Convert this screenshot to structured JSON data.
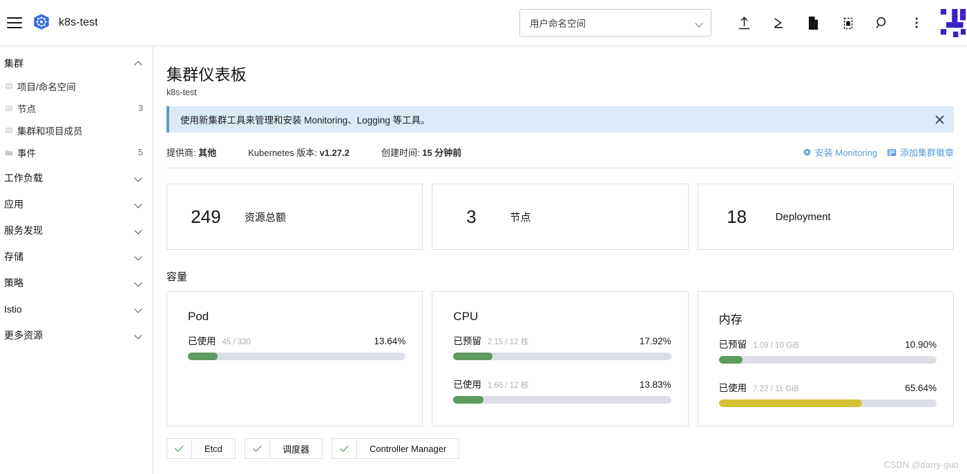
{
  "header": {
    "menu_icon": "hamburger-menu-icon",
    "cluster_logo": "kubernetes-icon",
    "cluster_name": "k8s-test",
    "namespace_filter": {
      "value": "用户命名空间",
      "caret_icon": "chevron-down-icon"
    },
    "icons": [
      {
        "name": "import-yaml-icon",
        "title": "导入 YAML"
      },
      {
        "name": "kubectl-shell-icon",
        "title": "Kubectl Shell"
      },
      {
        "name": "cluster-dashboard-icon",
        "title": "集群仪表板"
      },
      {
        "name": "copy-kubeconfig-icon",
        "title": "复制 KubeConfig"
      },
      {
        "name": "search-icon",
        "title": "搜索"
      },
      {
        "name": "more-options-icon",
        "title": "更多"
      }
    ],
    "brand_mark": "rancher-logo-icon"
  },
  "sidebar": {
    "groups": [
      {
        "label": "集群",
        "expanded": true,
        "caret_icon": "chevron-up-icon",
        "items": [
          {
            "label": "项目/命名空间",
            "count": "",
            "icon": "globe-icon"
          },
          {
            "label": "节点",
            "count": "3",
            "icon": "globe-icon"
          },
          {
            "label": "集群和项目成员",
            "count": "",
            "icon": "globe-icon"
          },
          {
            "label": "事件",
            "count": "5",
            "icon": "folder-icon"
          }
        ]
      },
      {
        "label": "工作负载",
        "expanded": false,
        "caret_icon": "chevron-down-icon",
        "items": []
      },
      {
        "label": "应用",
        "expanded": false,
        "caret_icon": "chevron-down-icon",
        "items": []
      },
      {
        "label": "服务发现",
        "expanded": false,
        "caret_icon": "chevron-down-icon",
        "items": []
      },
      {
        "label": "存储",
        "expanded": false,
        "caret_icon": "chevron-down-icon",
        "items": []
      },
      {
        "label": "策略",
        "expanded": false,
        "caret_icon": "chevron-down-icon",
        "items": []
      },
      {
        "label": "Istio",
        "expanded": false,
        "caret_icon": "chevron-down-icon",
        "items": []
      },
      {
        "label": "更多资源",
        "expanded": false,
        "caret_icon": "chevron-down-icon",
        "items": []
      }
    ]
  },
  "main": {
    "title": "集群仪表板",
    "subtitle": "k8s-test",
    "banner": {
      "text": "使用新集群工具来管理和安装 Monitoring、Logging 等工具。",
      "close_icon": "close-icon",
      "accent_color": "#5b9bd5",
      "background_color": "#dceaf7"
    },
    "meta": {
      "provider_label": "提供商:",
      "provider_value": "其他",
      "k8s_label": "Kubernetes 版本:",
      "k8s_value": "v1.27.2",
      "created_label": "创建时间:",
      "created_value": "15 分钟前",
      "links": [
        {
          "label": "安装 Monitoring",
          "icon": "gear-icon"
        },
        {
          "label": "添加集群徽章",
          "icon": "badge-icon"
        }
      ],
      "link_color": "#5b9bd5"
    },
    "stats": [
      {
        "value": "249",
        "label": "资源总额"
      },
      {
        "value": "3",
        "label": "节点"
      },
      {
        "value": "18",
        "label": "Deployment"
      }
    ],
    "capacity_section_title": "容量",
    "capacity_cards": [
      {
        "title": "Pod",
        "gauges": [
          {
            "name": "已使用",
            "detail": "45 / 330",
            "percent_label": "13.64%",
            "percent": 13.64,
            "color": "#5d9a5d"
          }
        ]
      },
      {
        "title": "CPU",
        "gauges": [
          {
            "name": "已预留",
            "detail": "2.15 / 12 核",
            "percent_label": "17.92%",
            "percent": 17.92,
            "color": "#5d9a5d"
          },
          {
            "name": "已使用",
            "detail": "1.66 / 12 核",
            "percent_label": "13.83%",
            "percent": 13.83,
            "color": "#5d9a5d"
          }
        ]
      },
      {
        "title": "内存",
        "gauges": [
          {
            "name": "已预留",
            "detail": "1.09 / 10 GiB",
            "percent_label": "10.90%",
            "percent": 10.9,
            "color": "#5d9a5d"
          },
          {
            "name": "已使用",
            "detail": "7.22 / 11 GiB",
            "percent_label": "65.64%",
            "percent": 65.64,
            "color": "#d5c133"
          }
        ]
      }
    ],
    "components": [
      {
        "name": "Etcd",
        "status_icon": "check-icon"
      },
      {
        "name": "调度器",
        "status_icon": "check-icon"
      },
      {
        "name": "Controller Manager",
        "status_icon": "check-icon"
      }
    ]
  },
  "watermark": "CSDN @darry-guo"
}
